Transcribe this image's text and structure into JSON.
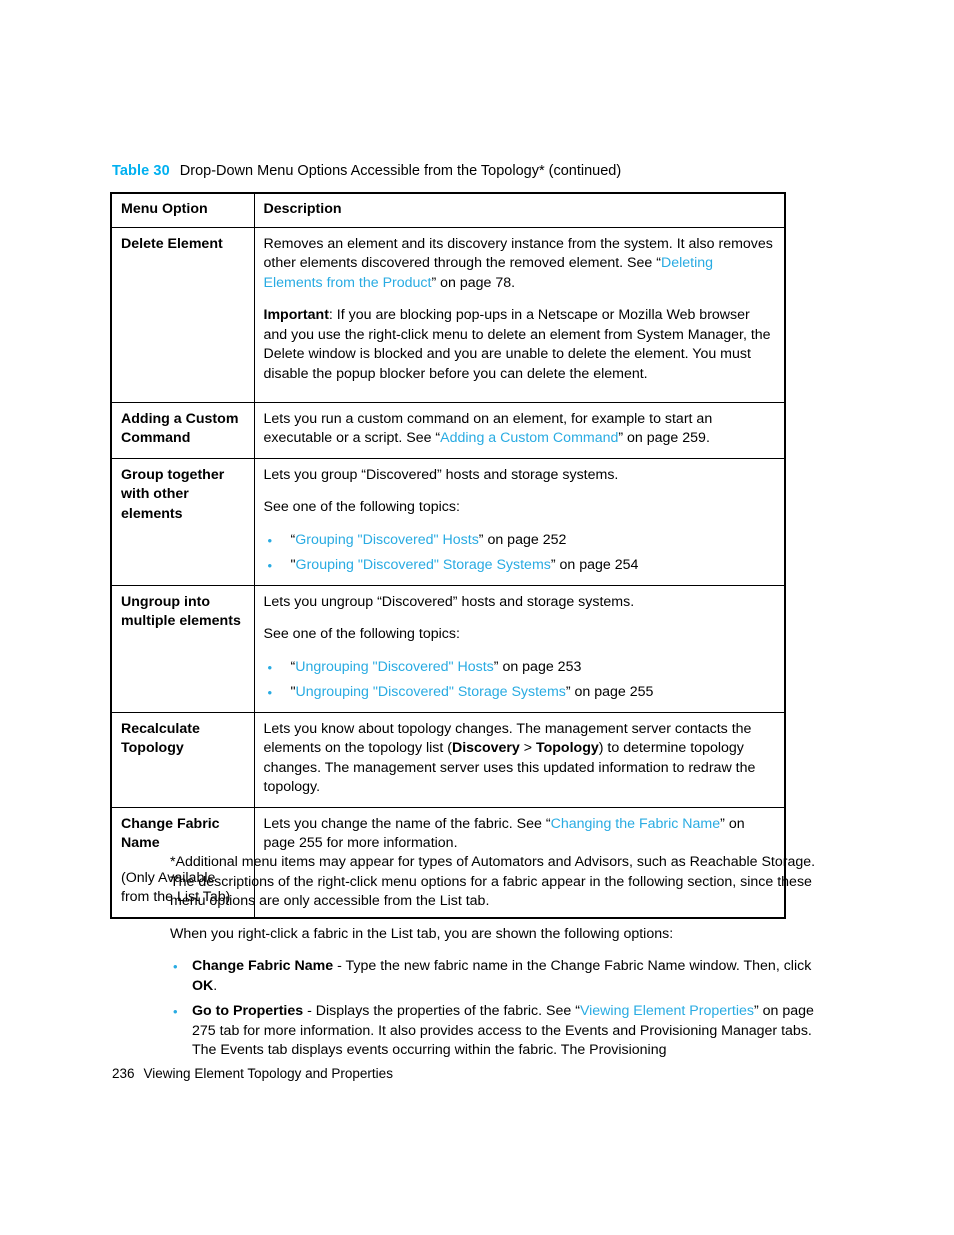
{
  "caption": {
    "label": "Table 30",
    "text": "Drop-Down Menu Options Accessible from the Topology* (continued)"
  },
  "colors": {
    "link": "#29abe2",
    "caption_label": "#00b0f0",
    "bullet": "#29abe2",
    "text": "#000000"
  },
  "table": {
    "headers": {
      "option": "Menu Option",
      "description": "Description"
    },
    "rows": [
      {
        "option": "Delete Element",
        "option_note": "",
        "paragraphs": [
          {
            "runs": [
              {
                "t": "Removes an element and its discovery instance from the system. It also removes other elements discovered through the removed element. See “",
                "style": "normal"
              },
              {
                "t": "Deleting Elements from the Product",
                "style": "link"
              },
              {
                "t": "” on page 78.",
                "style": "normal"
              }
            ]
          },
          {
            "runs": [
              {
                "t": "Important",
                "style": "bold"
              },
              {
                "t": ": If you are blocking pop-ups in a Netscape or Mozilla Web browser and you use the right-click menu to delete an element from System Manager, the Delete window is blocked and you are unable to delete the element. You must disable the popup blocker before you can delete the element.",
                "style": "normal"
              }
            ]
          }
        ],
        "list": []
      },
      {
        "option": "Adding a Custom Command",
        "option_note": "",
        "paragraphs": [
          {
            "runs": [
              {
                "t": "Lets you run a custom command on an element, for example to start an executable or a script. See “",
                "style": "normal"
              },
              {
                "t": "Adding a Custom Command",
                "style": "link"
              },
              {
                "t": "” on page 259.",
                "style": "normal"
              }
            ]
          }
        ],
        "list": []
      },
      {
        "option": "Group together with other elements",
        "option_note": "",
        "paragraphs": [
          {
            "runs": [
              {
                "t": "Lets you group “Discovered” hosts and storage systems.",
                "style": "normal"
              }
            ]
          },
          {
            "runs": [
              {
                "t": "See one of the following topics:",
                "style": "normal"
              }
            ]
          }
        ],
        "list": [
          {
            "runs": [
              {
                "t": "“",
                "style": "normal"
              },
              {
                "t": "Grouping \"Discovered\" Hosts",
                "style": "link"
              },
              {
                "t": "” on page 252",
                "style": "normal"
              }
            ]
          },
          {
            "runs": [
              {
                "t": "\"",
                "style": "normal"
              },
              {
                "t": "Grouping \"Discovered\" Storage Systems",
                "style": "link"
              },
              {
                "t": "” on page 254",
                "style": "normal"
              }
            ]
          }
        ]
      },
      {
        "option": "Ungroup into multiple elements",
        "option_note": "",
        "paragraphs": [
          {
            "runs": [
              {
                "t": "Lets you ungroup “Discovered” hosts and storage systems.",
                "style": "normal"
              }
            ]
          },
          {
            "runs": [
              {
                "t": "See one of the following topics:",
                "style": "normal"
              }
            ]
          }
        ],
        "list": [
          {
            "runs": [
              {
                "t": "“",
                "style": "normal"
              },
              {
                "t": "Ungrouping \"Discovered\" Hosts",
                "style": "link"
              },
              {
                "t": "” on page 253",
                "style": "normal"
              }
            ]
          },
          {
            "runs": [
              {
                "t": "\"",
                "style": "normal"
              },
              {
                "t": "Ungrouping \"Discovered\" Storage Systems",
                "style": "link"
              },
              {
                "t": "” on page 255",
                "style": "normal"
              }
            ]
          }
        ]
      },
      {
        "option": "Recalculate Topology",
        "option_note": "",
        "paragraphs": [
          {
            "runs": [
              {
                "t": "Lets you know about topology changes. The management server contacts the elements on the topology list (",
                "style": "normal"
              },
              {
                "t": "Discovery",
                "style": "bold"
              },
              {
                "t": " > ",
                "style": "normal"
              },
              {
                "t": "Topology",
                "style": "bold"
              },
              {
                "t": ") to determine topology changes. The management server uses this updated information to redraw the topology.",
                "style": "normal"
              }
            ]
          }
        ],
        "list": []
      },
      {
        "option": "Change Fabric Name",
        "option_note": "(Only Available from the List Tab)",
        "paragraphs": [
          {
            "runs": [
              {
                "t": "Lets you change the name of the fabric. See “",
                "style": "normal"
              },
              {
                "t": "Changing the Fabric Name",
                "style": "link"
              },
              {
                "t": "” on page 255 for more information.",
                "style": "normal"
              }
            ]
          }
        ],
        "list": []
      }
    ]
  },
  "body": {
    "paragraphs": [
      {
        "runs": [
          {
            "t": "*Additional menu items may appear for types of Automators and Advisors, such as Reachable Storage. The descriptions of the right-click menu options for a fabric appear in the following section, since these menu options are only accessible from the List tab.",
            "style": "normal"
          }
        ]
      },
      {
        "runs": [
          {
            "t": "When you right-click a fabric in the List tab, you are shown the following options:",
            "style": "normal"
          }
        ]
      }
    ],
    "list": [
      {
        "runs": [
          {
            "t": "Change Fabric Name",
            "style": "bold"
          },
          {
            "t": " - Type the new fabric name in the Change Fabric Name window. Then, click ",
            "style": "normal"
          },
          {
            "t": "OK",
            "style": "bold"
          },
          {
            "t": ".",
            "style": "normal"
          }
        ]
      },
      {
        "runs": [
          {
            "t": "Go to Properties",
            "style": "bold"
          },
          {
            "t": " - Displays the properties of the fabric. See “",
            "style": "normal"
          },
          {
            "t": "Viewing Element Properties",
            "style": "link"
          },
          {
            "t": "” on page 275 tab for more information. It also provides access to the Events and Provisioning Manager tabs. The Events tab displays events occurring within the fabric. The Provisioning",
            "style": "normal"
          }
        ]
      }
    ]
  },
  "footer": {
    "page_number": "236",
    "chapter_title": "Viewing Element Topology and Properties"
  },
  "bullet_glyph": "•"
}
